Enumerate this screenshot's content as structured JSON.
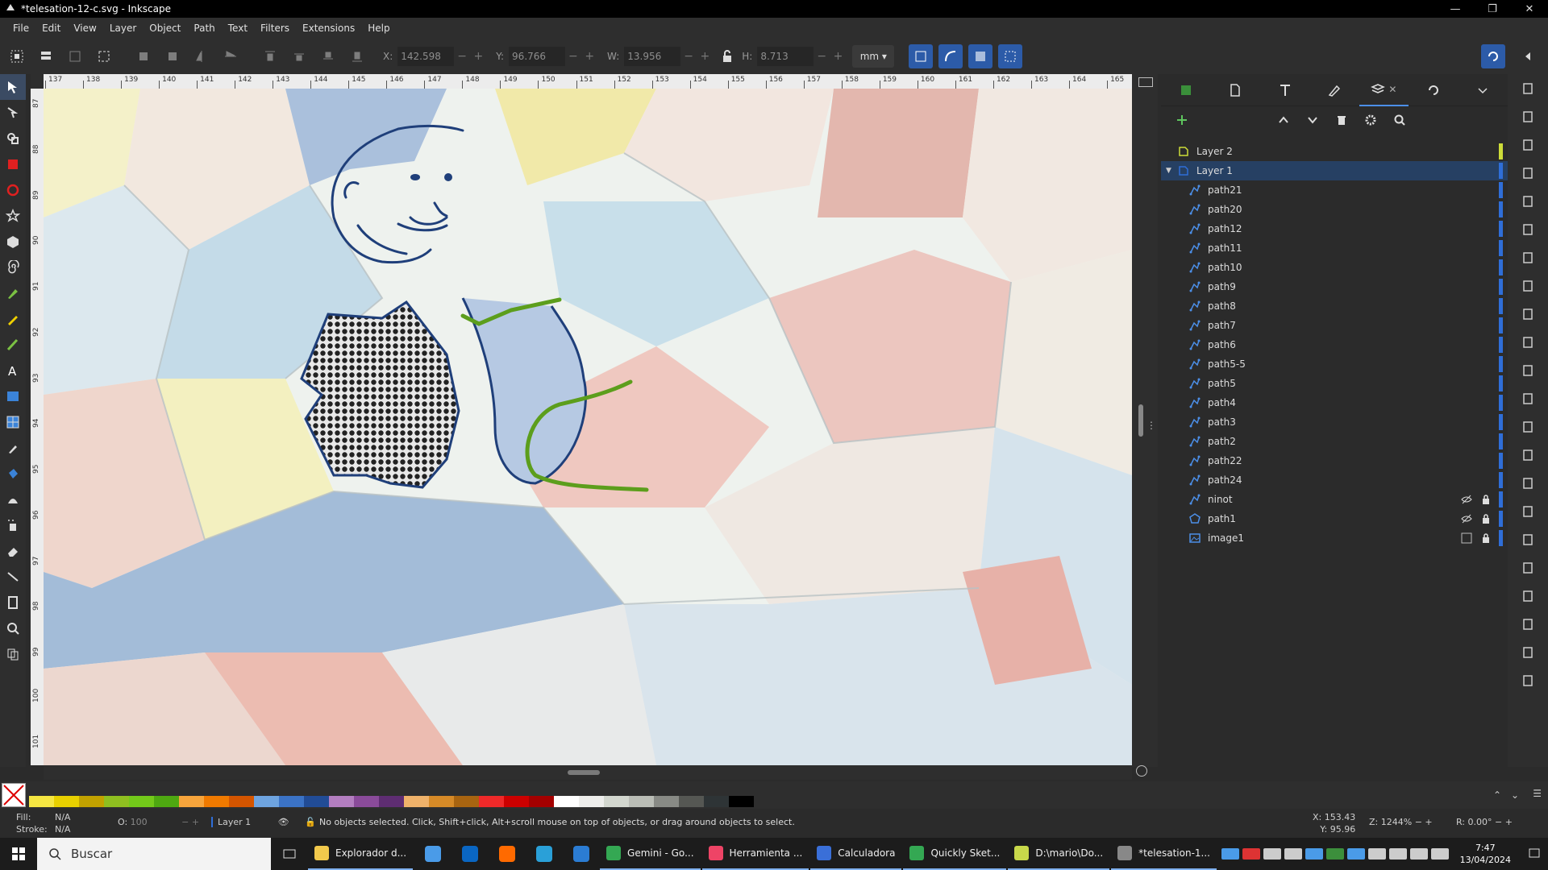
{
  "window": {
    "title": "*telesation-12-c.svg - Inkscape"
  },
  "menu": [
    "File",
    "Edit",
    "View",
    "Layer",
    "Object",
    "Path",
    "Text",
    "Filters",
    "Extensions",
    "Help"
  ],
  "toolctrl": {
    "x_label": "X:",
    "x_value": "142.598",
    "y_label": "Y:",
    "y_value": "96.766",
    "w_label": "W:",
    "w_value": "13.956",
    "h_label": "H:",
    "h_value": "8.713",
    "unit": "mm"
  },
  "ruler": {
    "top": [
      "137",
      "138",
      "139",
      "140",
      "141",
      "142",
      "143",
      "144",
      "145",
      "146",
      "147",
      "148",
      "149",
      "150",
      "151",
      "152",
      "153",
      "154",
      "155",
      "156",
      "157",
      "158",
      "159",
      "160",
      "161",
      "162",
      "163",
      "164",
      "165"
    ],
    "left": [
      "87",
      "88",
      "89",
      "90",
      "91",
      "92",
      "93",
      "94",
      "95",
      "96",
      "97",
      "98",
      "99",
      "100",
      "101"
    ]
  },
  "layers": [
    {
      "name": "Layer 2",
      "kind": "layer",
      "color": "#cddc39",
      "indent": 1,
      "selected": false
    },
    {
      "name": "Layer 1",
      "kind": "layer",
      "color": "#2f6ed8",
      "indent": 1,
      "selected": true
    },
    {
      "name": "path21",
      "kind": "path",
      "indent": 2
    },
    {
      "name": "path20",
      "kind": "path",
      "indent": 2
    },
    {
      "name": "path12",
      "kind": "path",
      "indent": 2
    },
    {
      "name": "path11",
      "kind": "path",
      "indent": 2
    },
    {
      "name": "path10",
      "kind": "path",
      "indent": 2
    },
    {
      "name": "path9",
      "kind": "path",
      "indent": 2
    },
    {
      "name": "path8",
      "kind": "path",
      "indent": 2
    },
    {
      "name": "path7",
      "kind": "path",
      "indent": 2
    },
    {
      "name": "path6",
      "kind": "path",
      "indent": 2
    },
    {
      "name": "path5-5",
      "kind": "path",
      "indent": 2
    },
    {
      "name": "path5",
      "kind": "path",
      "indent": 2
    },
    {
      "name": "path4",
      "kind": "path",
      "indent": 2
    },
    {
      "name": "path3",
      "kind": "path",
      "indent": 2
    },
    {
      "name": "path2",
      "kind": "path",
      "indent": 2
    },
    {
      "name": "path22",
      "kind": "path",
      "indent": 2
    },
    {
      "name": "path24",
      "kind": "path",
      "indent": 2
    },
    {
      "name": "ninot",
      "kind": "path",
      "indent": 2,
      "hidden": true,
      "locked": true
    },
    {
      "name": "path1",
      "kind": "polygon",
      "indent": 2,
      "hidden": true,
      "locked": true
    },
    {
      "name": "image1",
      "kind": "image",
      "indent": 2,
      "locked": true
    }
  ],
  "palette": [
    "#f5e642",
    "#e8d000",
    "#c2a200",
    "#8fbf20",
    "#73c91a",
    "#4ea811",
    "#f7a53c",
    "#f07a00",
    "#d45500",
    "#6ea4e0",
    "#3b73c6",
    "#214c96",
    "#b37ec0",
    "#8a4b9a",
    "#5e2d72",
    "#efb26a",
    "#d68a27",
    "#a86410",
    "#ef2929",
    "#cc0000",
    "#a40000",
    "#ffffff",
    "#eeeeec",
    "#d3d7cf",
    "#babdb6",
    "#888a85",
    "#555753",
    "#2e3436",
    "#000000"
  ],
  "status": {
    "fill_label": "Fill:",
    "fill_value": "N/A",
    "stroke_label": "Stroke:",
    "stroke_value": "N/A",
    "opacity_label": "O:",
    "opacity_value": "100",
    "layer": "Layer 1",
    "message": "No objects selected. Click, Shift+click, Alt+scroll mouse on top of objects, or drag around objects to select.",
    "x_label": "X:",
    "x": "153.43",
    "y_label": "Y:",
    "y": "95.96",
    "zoom_label": "Z:",
    "zoom": "1244%",
    "rot_label": "R:",
    "rotation": "0.00°"
  },
  "taskbar": {
    "search": "Buscar",
    "apps": [
      {
        "label": "Explorador d...",
        "color": "#f2c94c"
      },
      {
        "label": "Gemini - Go...",
        "color": "#34a853"
      },
      {
        "label": "Herramienta ...",
        "color": "#e46"
      },
      {
        "label": "Calculadora",
        "color": "#3a6fd8"
      },
      {
        "label": "Quickly Sket...",
        "color": "#34a853"
      },
      {
        "label": "D:\\mario\\Do...",
        "color": "#c8d84a"
      },
      {
        "label": "*telesation-1...",
        "color": "#888"
      }
    ],
    "time": "7:47",
    "date": "13/04/2024"
  }
}
